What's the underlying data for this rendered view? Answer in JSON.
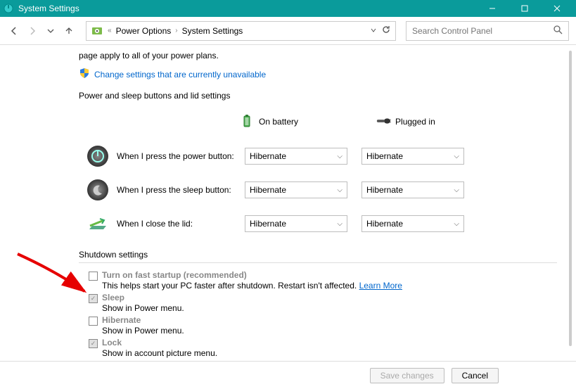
{
  "window": {
    "title": "System Settings"
  },
  "breadcrumb": {
    "level1": "Power Options",
    "level2": "System Settings"
  },
  "search": {
    "placeholder": "Search Control Panel"
  },
  "truncated_text": "page apply to all of your power plans.",
  "admin_link": "Change settings that are currently unavailable",
  "section1": {
    "heading": "Power and sleep buttons and lid settings",
    "col_battery": "On battery",
    "col_plugged": "Plugged in"
  },
  "rows": {
    "power": {
      "label": "When I press the power button:",
      "battery": "Hibernate",
      "plugged": "Hibernate"
    },
    "sleep": {
      "label": "When I press the sleep button:",
      "battery": "Hibernate",
      "plugged": "Hibernate"
    },
    "lid": {
      "label": "When I close the lid:",
      "battery": "Hibernate",
      "plugged": "Hibernate"
    }
  },
  "section2": {
    "heading": "Shutdown settings",
    "items": [
      {
        "title": "Turn on fast startup (recommended)",
        "desc": "This helps start your PC faster after shutdown. Restart isn't affected.",
        "learn": "Learn More"
      },
      {
        "title": "Sleep",
        "desc": "Show in Power menu."
      },
      {
        "title": "Hibernate",
        "desc": "Show in Power menu."
      },
      {
        "title": "Lock",
        "desc": "Show in account picture menu."
      }
    ]
  },
  "footer": {
    "save": "Save changes",
    "cancel": "Cancel"
  }
}
